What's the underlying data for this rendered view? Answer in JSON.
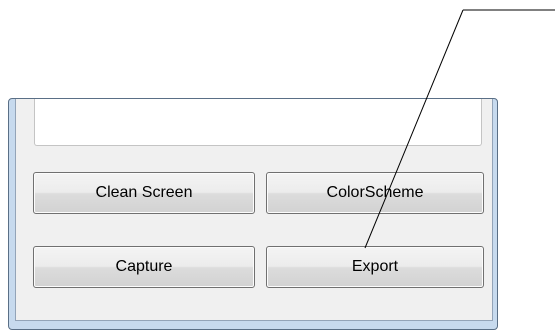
{
  "buttons": {
    "clean_screen": "Clean Screen",
    "color_scheme": "ColorScheme",
    "capture": "Capture",
    "export": "Export"
  },
  "colors": {
    "frame": "#c7daee",
    "client": "#f0f0f0",
    "callout_line": "#000000"
  }
}
